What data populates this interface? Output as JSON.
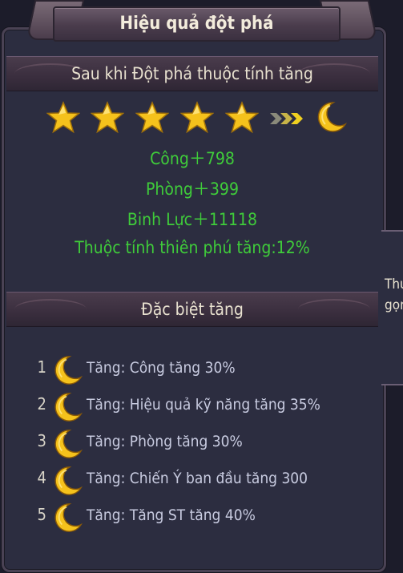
{
  "title": "Hiệu quả đột phá",
  "section1": {
    "heading": "Sau khi Đột phá thuộc tính tăng",
    "stars_before": 5,
    "result_icon": "moon-icon",
    "stats": [
      "Công＋798",
      "Phòng＋399",
      "Binh Lực＋11118",
      "Thuộc tính thiên phú tăng:12%"
    ]
  },
  "section2": {
    "heading": "Đặc biệt tăng",
    "items": [
      {
        "num": "1",
        "text": "Tăng:  Công tăng 30%"
      },
      {
        "num": "2",
        "text": "Tăng:  Hiệu quả kỹ năng tăng 35%"
      },
      {
        "num": "3",
        "text": "Tăng:  Phòng tăng 30%"
      },
      {
        "num": "4",
        "text": "Tăng:  Chiến Ý ban đầu tăng 300"
      },
      {
        "num": "5",
        "text": "Tăng:  Tăng ST tăng 40%"
      }
    ]
  },
  "side_tab": {
    "line1": "Thu",
    "line2": "gọn"
  },
  "colors": {
    "green": "#3fcc3a",
    "gold": "#f5c21c",
    "panel": "#2c2d40"
  }
}
